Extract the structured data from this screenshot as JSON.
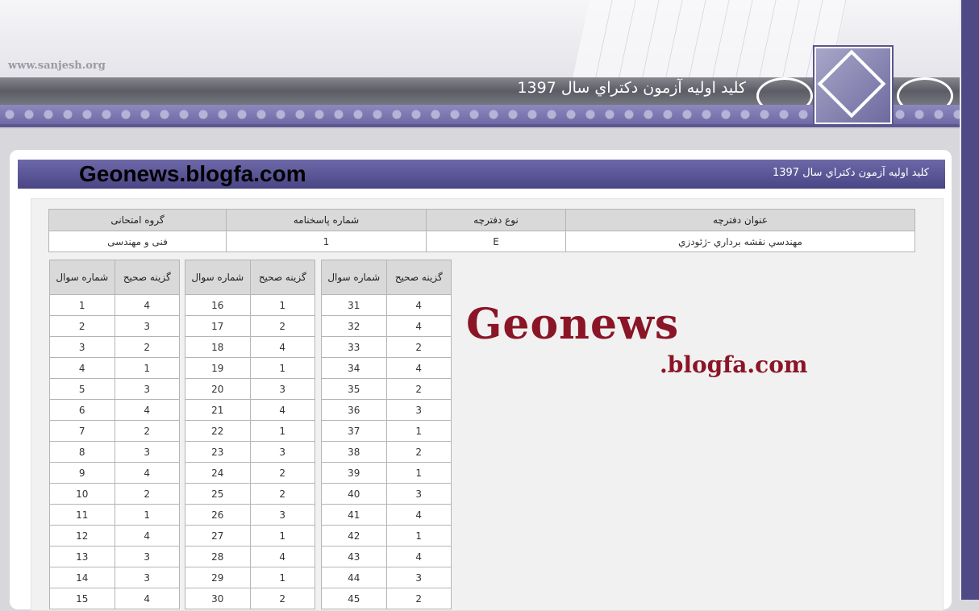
{
  "header": {
    "site_url": "www.sanjesh.org",
    "title": "كليد اوليه آزمون دكتراي سال 1397"
  },
  "panel": {
    "title_left": "Geonews.blogfa.com",
    "title_right": "كليد اوليه آزمون دكتراي سال 1397"
  },
  "info_table": {
    "headers": [
      "عنوان دفترچه",
      "نوع دفترچه",
      "شماره پاسخنامه",
      "گروه امتحانی"
    ],
    "row": [
      "مهندسي نقشه برداري -ژئودزي",
      "E",
      "1",
      "فنی و مهندسی"
    ]
  },
  "answer_headers": {
    "question": "شماره سوال",
    "answer": "گزینه صحیح"
  },
  "answers": [
    {
      "q": "1",
      "a": "4"
    },
    {
      "q": "2",
      "a": "3"
    },
    {
      "q": "3",
      "a": "2"
    },
    {
      "q": "4",
      "a": "1"
    },
    {
      "q": "5",
      "a": "3"
    },
    {
      "q": "6",
      "a": "4"
    },
    {
      "q": "7",
      "a": "2"
    },
    {
      "q": "8",
      "a": "3"
    },
    {
      "q": "9",
      "a": "4"
    },
    {
      "q": "10",
      "a": "2"
    },
    {
      "q": "11",
      "a": "1"
    },
    {
      "q": "12",
      "a": "4"
    },
    {
      "q": "13",
      "a": "3"
    },
    {
      "q": "14",
      "a": "3"
    },
    {
      "q": "15",
      "a": "4"
    },
    {
      "q": "16",
      "a": "1"
    },
    {
      "q": "17",
      "a": "2"
    },
    {
      "q": "18",
      "a": "4"
    },
    {
      "q": "19",
      "a": "1"
    },
    {
      "q": "20",
      "a": "3"
    },
    {
      "q": "21",
      "a": "4"
    },
    {
      "q": "22",
      "a": "1"
    },
    {
      "q": "23",
      "a": "3"
    },
    {
      "q": "24",
      "a": "2"
    },
    {
      "q": "25",
      "a": "2"
    },
    {
      "q": "26",
      "a": "3"
    },
    {
      "q": "27",
      "a": "1"
    },
    {
      "q": "28",
      "a": "4"
    },
    {
      "q": "29",
      "a": "1"
    },
    {
      "q": "30",
      "a": "2"
    },
    {
      "q": "31",
      "a": "4"
    },
    {
      "q": "32",
      "a": "4"
    },
    {
      "q": "33",
      "a": "2"
    },
    {
      "q": "34",
      "a": "4"
    },
    {
      "q": "35",
      "a": "2"
    },
    {
      "q": "36",
      "a": "3"
    },
    {
      "q": "37",
      "a": "1"
    },
    {
      "q": "38",
      "a": "2"
    },
    {
      "q": "39",
      "a": "1"
    },
    {
      "q": "40",
      "a": "3"
    },
    {
      "q": "41",
      "a": "4"
    },
    {
      "q": "42",
      "a": "1"
    },
    {
      "q": "43",
      "a": "4"
    },
    {
      "q": "44",
      "a": "3"
    },
    {
      "q": "45",
      "a": "2"
    }
  ],
  "watermark": {
    "main": "Geonews",
    "sub": ".blogfa.com",
    "color": "#8a1526"
  }
}
